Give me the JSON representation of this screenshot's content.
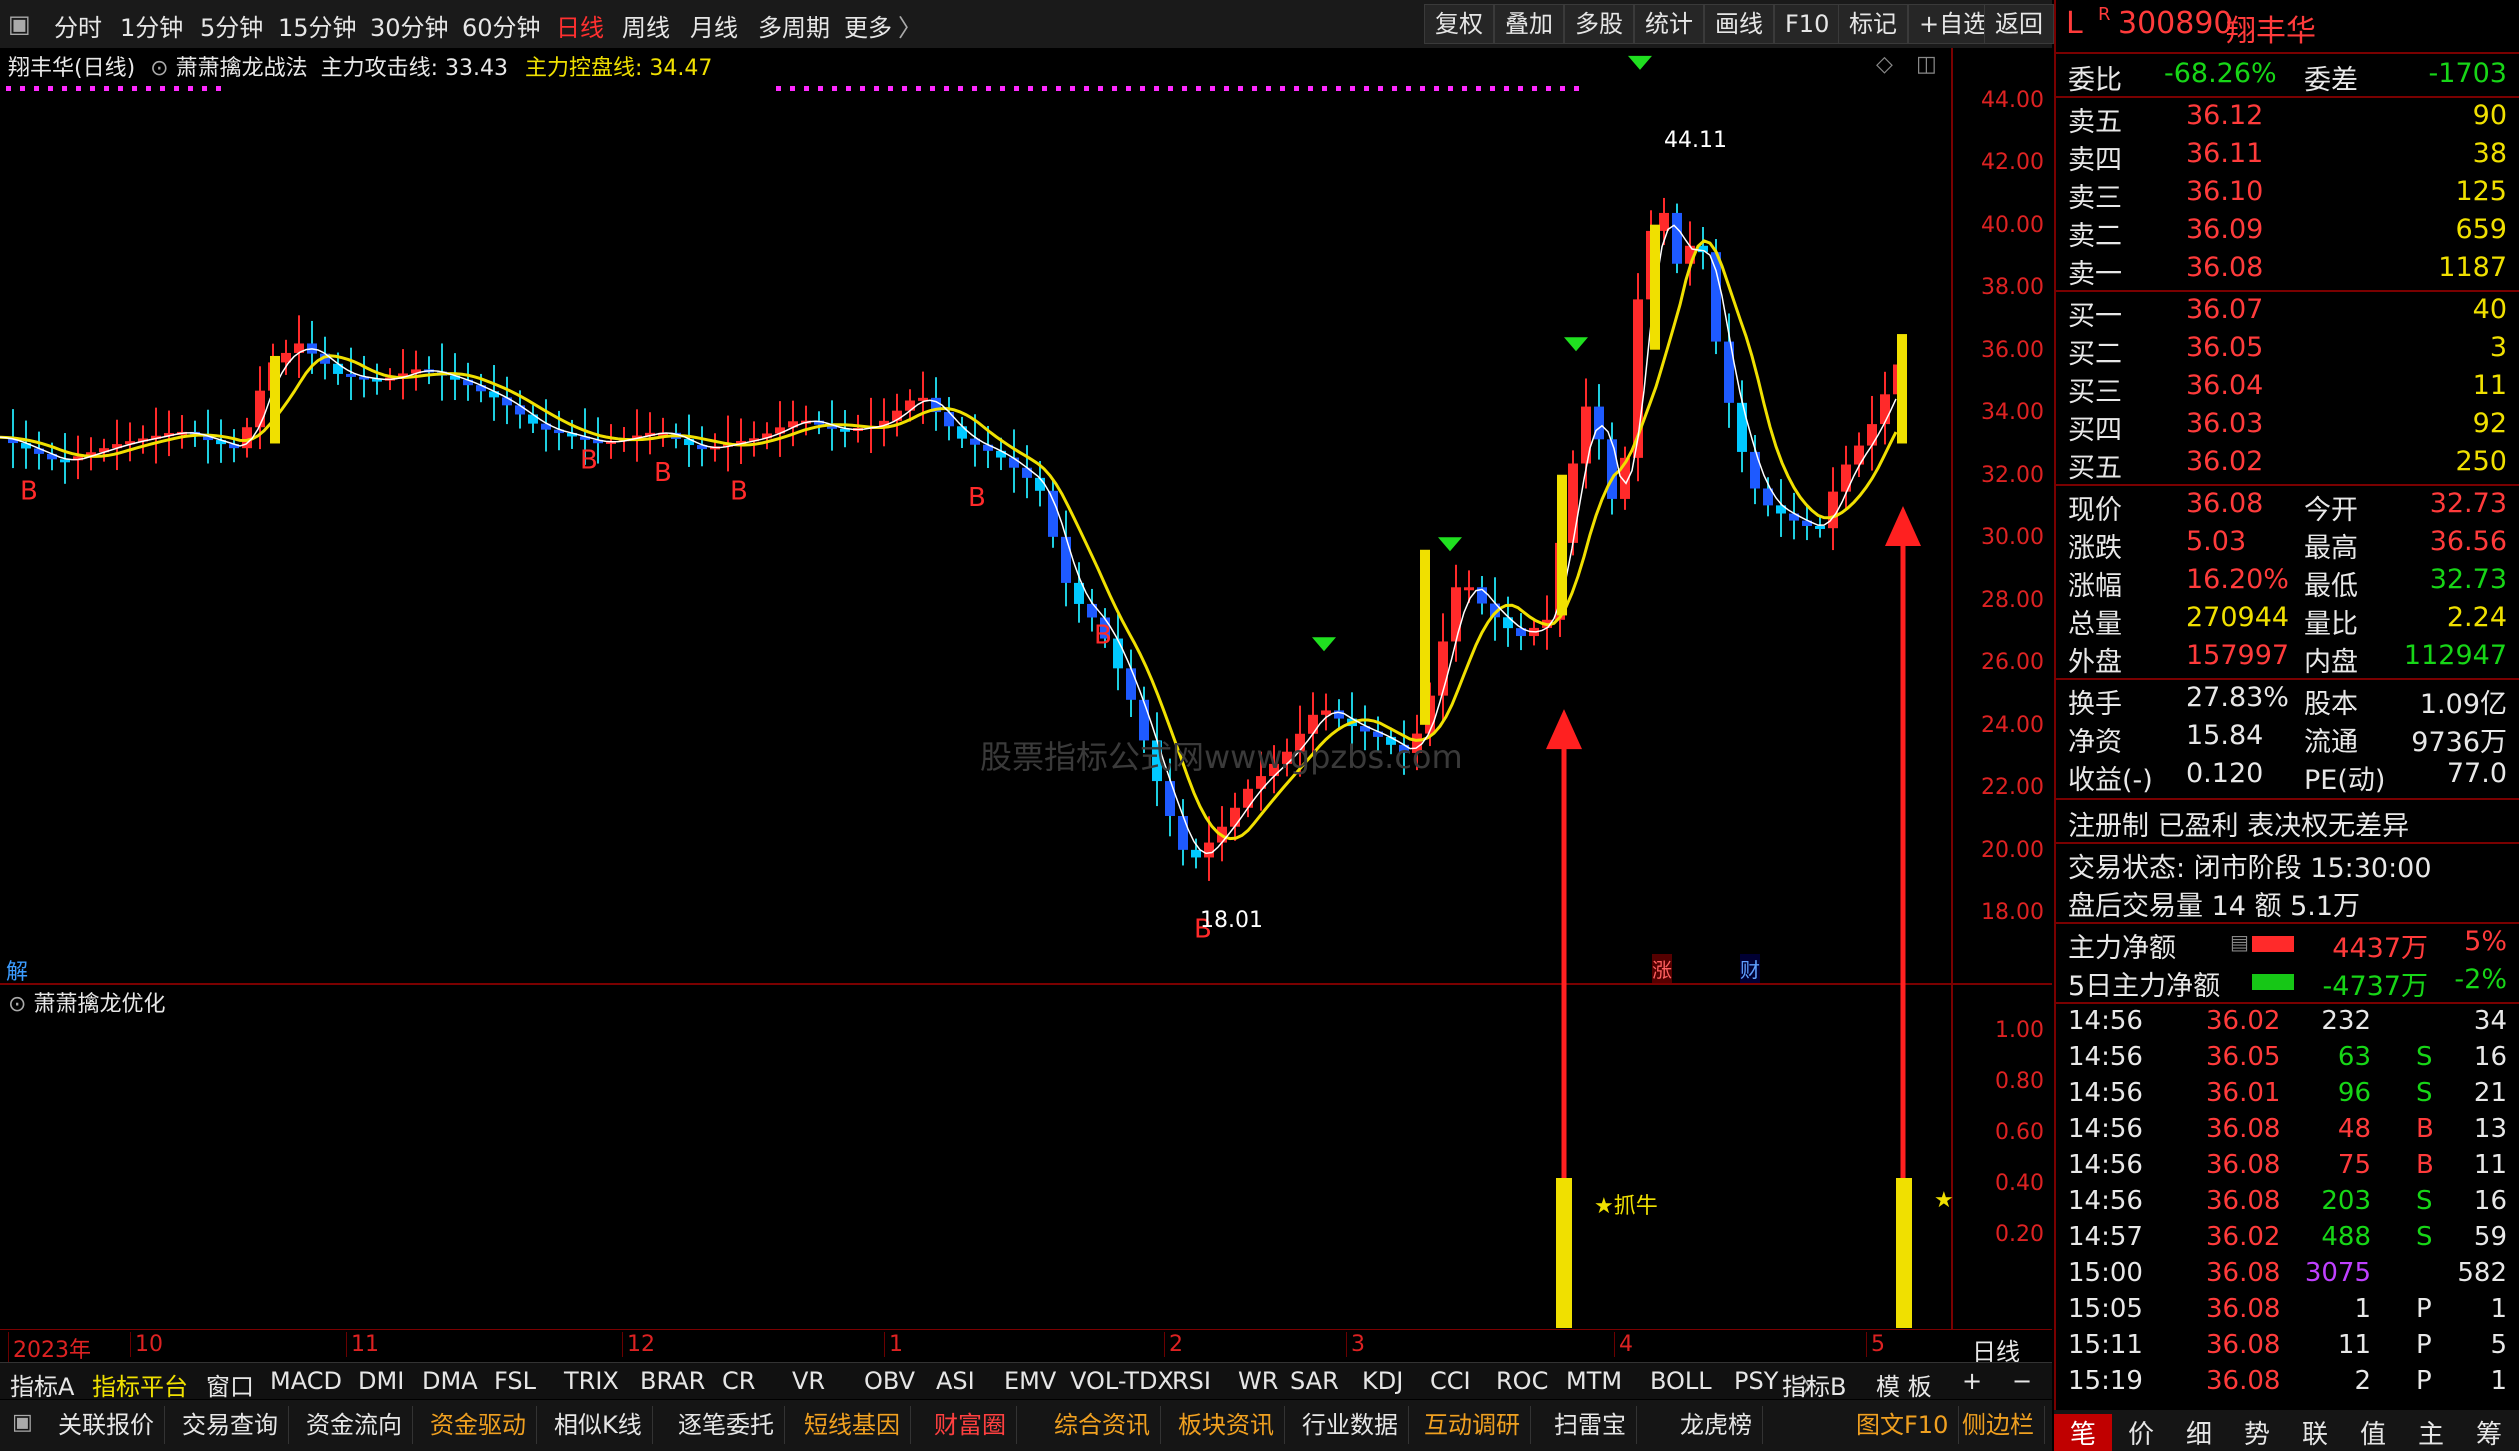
{
  "topbar": {
    "periods": [
      "分时",
      "1分钟",
      "5分钟",
      "15分钟",
      "30分钟",
      "60分钟",
      "日线",
      "周线",
      "月线",
      "多周期",
      "更多"
    ],
    "active": "日线",
    "tools": [
      "复权",
      "叠加",
      "多股",
      "统计",
      "画线",
      "F10",
      "标记",
      "+自选",
      "返回"
    ]
  },
  "legend": {
    "title": "翔丰华(日线)",
    "formula": "萧萧擒龙战法",
    "attack_label": "主力攻击线: 33.43",
    "control_label": "主力控盘线: 34.47"
  },
  "sub_legend": "萧萧擒龙优化",
  "annotations": {
    "high": "44.11",
    "low": "18.01",
    "catch": "★抓牛",
    "jie": "解",
    "zhang": "涨",
    "cai": "财",
    "watermark": "股票指标公式网www.gpzbs.com"
  },
  "price_axis": [
    "44.00",
    "42.00",
    "40.00",
    "38.00",
    "36.00",
    "34.00",
    "32.00",
    "30.00",
    "28.00",
    "26.00",
    "24.00",
    "22.00",
    "20.00",
    "18.00"
  ],
  "sub_axis": [
    "1.00",
    "0.80",
    "0.60",
    "0.40",
    "0.20"
  ],
  "date_axis": [
    "2023年",
    "10",
    "11",
    "12",
    "1",
    "2",
    "3",
    "4",
    "5"
  ],
  "date_axis_right": "日线",
  "indicator_tabs": [
    "指标A",
    "指标平台",
    "窗口",
    "MACD",
    "DMI",
    "DMA",
    "FSL",
    "TRIX",
    "BRAR",
    "CR",
    "VR",
    "OBV",
    "ASI",
    "EMV",
    "VOL-TDX",
    "RSI",
    "WR",
    "SAR",
    "KDJ",
    "CCI",
    "ROC",
    "MTM",
    "BOLL",
    "PSY"
  ],
  "indicator_right": [
    "指标B",
    "模 板",
    "+",
    "−"
  ],
  "func_tabs": [
    "关联报价",
    "交易查询",
    "资金流向",
    "资金驱动",
    "相似K线",
    "逐笔委托",
    "短线基因",
    "财富圈",
    "综合资讯",
    "板块资讯",
    "行业数据",
    "互动调研",
    "扫雷宝",
    "龙虎榜",
    "图文F10",
    "侧边栏"
  ],
  "stock": {
    "flag": "L",
    "r": "R",
    "code": "300890",
    "name": "翔丰华"
  },
  "weibi": {
    "label1": "委比",
    "val1": "-68.26%",
    "label2": "委差",
    "val2": "-1703"
  },
  "asks": [
    {
      "label": "卖五",
      "price": "36.12",
      "vol": "90"
    },
    {
      "label": "卖四",
      "price": "36.11",
      "vol": "38"
    },
    {
      "label": "卖三",
      "price": "36.10",
      "vol": "125"
    },
    {
      "label": "卖二",
      "price": "36.09",
      "vol": "659"
    },
    {
      "label": "卖一",
      "price": "36.08",
      "vol": "1187"
    }
  ],
  "bids": [
    {
      "label": "买一",
      "price": "36.07",
      "vol": "40"
    },
    {
      "label": "买二",
      "price": "36.05",
      "vol": "3"
    },
    {
      "label": "买三",
      "price": "36.04",
      "vol": "11"
    },
    {
      "label": "买四",
      "price": "36.03",
      "vol": "92"
    },
    {
      "label": "买五",
      "price": "36.02",
      "vol": "250"
    }
  ],
  "quote": [
    {
      "l1": "现价",
      "v1": "36.08",
      "l2": "今开",
      "v2": "32.73"
    },
    {
      "l1": "涨跌",
      "v1": "5.03",
      "l2": "最高",
      "v2": "36.56"
    },
    {
      "l1": "涨幅",
      "v1": "16.20%",
      "l2": "最低",
      "v2": "32.73"
    },
    {
      "l1": "总量",
      "v1": "270944",
      "l2": "量比",
      "v2": "2.24"
    },
    {
      "l1": "外盘",
      "v1": "157997",
      "l2": "内盘",
      "v2": "112947"
    }
  ],
  "fund": [
    {
      "l1": "换手",
      "v1": "27.83%",
      "l2": "股本",
      "v2": "1.09亿"
    },
    {
      "l1": "净资",
      "v1": "15.84",
      "l2": "流通",
      "v2": "9736万"
    },
    {
      "l1": "收益(-)",
      "v1": "0.120",
      "l2": "PE(动)",
      "v2": "77.0"
    }
  ],
  "info": {
    "reg": "注册制 已盈利 表决权无差异",
    "state": "交易状态: 闭市阶段 15:30:00",
    "after": "盘后交易量 14 额 5.1万"
  },
  "flow": [
    {
      "label": "主力净额",
      "amt": "4437万",
      "pct": "5%"
    },
    {
      "label": "5日主力净额",
      "amt": "-4737万",
      "pct": "-2%"
    }
  ],
  "ticks": [
    {
      "t": "14:56",
      "p": "36.02",
      "v": "232",
      "f": "",
      "n": "34"
    },
    {
      "t": "14:56",
      "p": "36.05",
      "v": "63",
      "f": "S",
      "n": "16"
    },
    {
      "t": "14:56",
      "p": "36.01",
      "v": "96",
      "f": "S",
      "n": "21"
    },
    {
      "t": "14:56",
      "p": "36.08",
      "v": "48",
      "f": "B",
      "n": "13"
    },
    {
      "t": "14:56",
      "p": "36.08",
      "v": "75",
      "f": "B",
      "n": "11"
    },
    {
      "t": "14:56",
      "p": "36.08",
      "v": "203",
      "f": "S",
      "n": "16"
    },
    {
      "t": "14:57",
      "p": "36.02",
      "v": "488",
      "f": "S",
      "n": "59"
    },
    {
      "t": "15:00",
      "p": "36.08",
      "v": "3075",
      "f": "",
      "n": "582"
    },
    {
      "t": "15:05",
      "p": "36.08",
      "v": "1",
      "f": "P",
      "n": "1"
    },
    {
      "t": "15:11",
      "p": "36.08",
      "v": "11",
      "f": "P",
      "n": "5"
    },
    {
      "t": "15:19",
      "p": "36.08",
      "v": "2",
      "f": "P",
      "n": "1"
    }
  ],
  "right_tabs": [
    "笔",
    "价",
    "细",
    "势",
    "联",
    "值",
    "主",
    "筹"
  ],
  "chart_data": {
    "type": "candlestick",
    "ylim": [
      17,
      45
    ],
    "high_point": 44.11,
    "low_point": 18.01,
    "last_close": 36.08
  }
}
